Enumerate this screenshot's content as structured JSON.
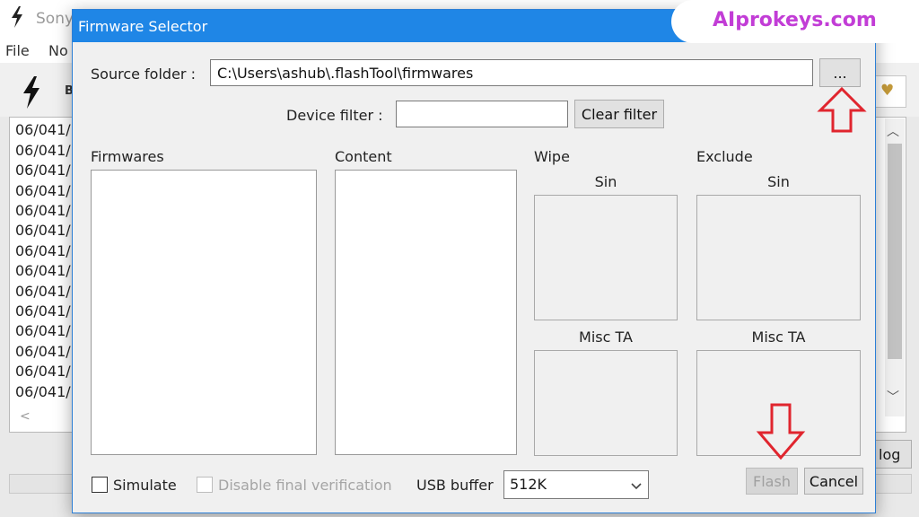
{
  "main_window": {
    "title": "Sony",
    "menu": [
      "File",
      "No"
    ],
    "toolbar_letter": "B",
    "log_lines": [
      "06/041/",
      "06/041/",
      "06/041/",
      "06/041/",
      "06/041/",
      "06/041/",
      "06/041/",
      "06/041/",
      "06/041/",
      "06/041/",
      "06/041/",
      "06/041/",
      "06/041/",
      "06/041/"
    ],
    "log_button": "log"
  },
  "dialog": {
    "title": "Firmware Selector",
    "source_folder_label": "Source folder :",
    "source_folder_value": "C:\\Users\\ashub\\.flashTool\\firmwares",
    "browse_label": "...",
    "device_filter_label": "Device filter :",
    "device_filter_value": "",
    "clear_filter_label": "Clear filter",
    "firmwares_label": "Firmwares",
    "content_label": "Content",
    "wipe_label": "Wipe",
    "exclude_label": "Exclude",
    "wipe_sin_label": "Sin",
    "wipe_misc_label": "Misc TA",
    "exclude_sin_label": "Sin",
    "exclude_misc_label": "Misc TA",
    "simulate_label": "Simulate",
    "simulate_checked": false,
    "disable_verification_label": "Disable final verification",
    "usb_buffer_label": "USB buffer",
    "usb_buffer_value": "512K",
    "flash_label": "Flash",
    "cancel_label": "Cancel"
  },
  "watermark": {
    "text": "AIprokeys.com"
  },
  "colors": {
    "dialog_titlebar": "#1f86e6",
    "annotation_arrow": "#e0252e",
    "watermark_text": "#c23dd6"
  }
}
